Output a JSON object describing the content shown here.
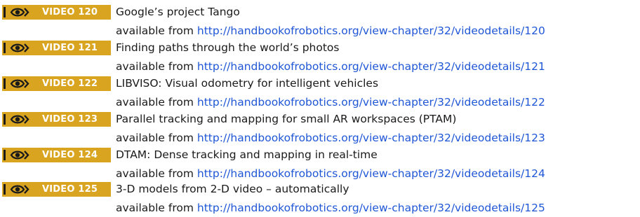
{
  "colors": {
    "badge": "#d9a521",
    "link": "#1f56d6",
    "text": "#1a1a1a"
  },
  "icon": "eye-icon",
  "videos": [
    {
      "badge": "VIDEO 120",
      "title": "Google’s project Tango",
      "prefix": "available from",
      "url": "http://handbookofrobotics.org/view-chapter/32/videodetails/120"
    },
    {
      "badge": "VIDEO 121",
      "title": "Finding paths through the world’s photos",
      "prefix": "available from",
      "url": "http://handbookofrobotics.org/view-chapter/32/videodetails/121"
    },
    {
      "badge": "VIDEO 122",
      "title": "LIBVISO: Visual odometry for intelligent vehicles",
      "prefix": "available from",
      "url": "http://handbookofrobotics.org/view-chapter/32/videodetails/122"
    },
    {
      "badge": "VIDEO 123",
      "title": "Parallel tracking and mapping for small AR workspaces (PTAM)",
      "prefix": "available from",
      "url": "http://handbookofrobotics.org/view-chapter/32/videodetails/123"
    },
    {
      "badge": "VIDEO 124",
      "title": "DTAM: Dense tracking and mapping in real-time",
      "prefix": "available from",
      "url": "http://handbookofrobotics.org/view-chapter/32/videodetails/124"
    },
    {
      "badge": "VIDEO 125",
      "title": "3-D models from 2-D video – automatically",
      "prefix": "available from",
      "url": "http://handbookofrobotics.org/view-chapter/32/videodetails/125"
    }
  ]
}
